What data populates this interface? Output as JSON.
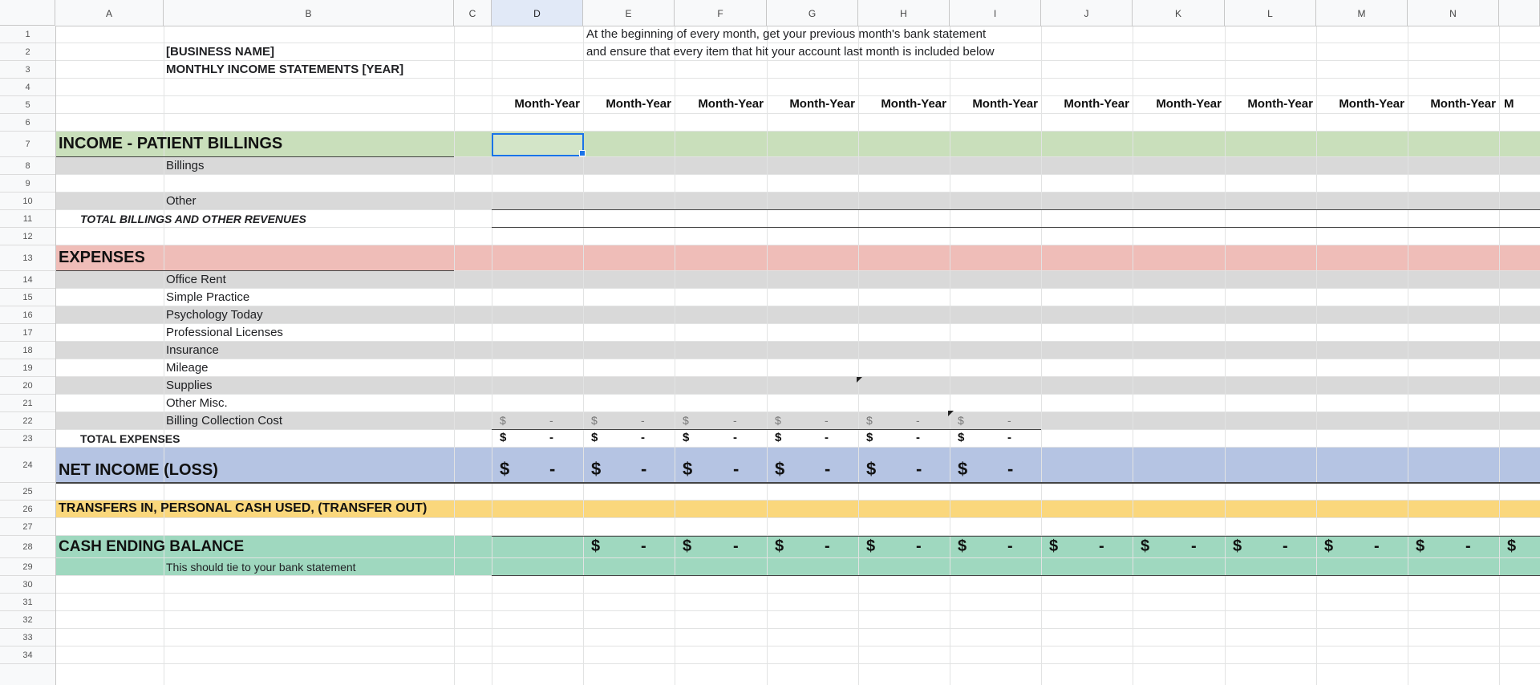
{
  "columns": [
    "A",
    "B",
    "C",
    "D",
    "E",
    "F",
    "G",
    "H",
    "I",
    "J",
    "K",
    "L",
    "M",
    "N"
  ],
  "rows": [
    "1",
    "2",
    "3",
    "4",
    "5",
    "6",
    "7",
    "8",
    "9",
    "10",
    "11",
    "12",
    "13",
    "14",
    "15",
    "16",
    "17",
    "18",
    "19",
    "20",
    "21",
    "22",
    "23",
    "24",
    "25",
    "26",
    "27",
    "28",
    "29",
    "30",
    "31",
    "32",
    "33",
    "34"
  ],
  "header_block": {
    "business_name": "[BUSINESS NAME]",
    "statement_title": "MONTHLY INCOME STATEMENTS [YEAR]",
    "note_line1": "At the beginning of every month, get your previous month's bank statement",
    "note_line2": "and ensure that every item that hit your account last month is included below"
  },
  "month_headers": [
    "Month-Year",
    "Month-Year",
    "Month-Year",
    "Month-Year",
    "Month-Year",
    "Month-Year",
    "Month-Year",
    "Month-Year",
    "Month-Year",
    "Month-Year",
    "Month-Year",
    "M"
  ],
  "income": {
    "title": "INCOME - PATIENT BILLINGS",
    "items": [
      "Billings",
      "Other"
    ],
    "total_label": "TOTAL BILLINGS AND OTHER REVENUES"
  },
  "expenses": {
    "title": "EXPENSES",
    "items": [
      "Office Rent",
      "Simple Practice",
      "Psychology Today",
      "Professional Licenses",
      "Insurance",
      "Mileage",
      "Supplies",
      "Other Misc.",
      "Billing Collection Cost"
    ],
    "total_label": "TOTAL EXPENSES"
  },
  "net_income": {
    "title": "NET INCOME (LOSS)"
  },
  "transfers": {
    "title": "TRANSFERS IN, PERSONAL CASH USED, (TRANSFER OUT)"
  },
  "cash_ending": {
    "title": "CASH ENDING BALANCE",
    "note": "This should tie to your bank statement"
  },
  "currency_symbol": "$",
  "dash": "-",
  "band_colors": {
    "income": "#c9dfbb",
    "expenses": "#efbdb8",
    "net_income": "#b5c4e3",
    "transfers": "#fad77c",
    "cash_ending": "#9fd8bf",
    "stripe": "#d9d9d9"
  },
  "selected_cell": "D7"
}
